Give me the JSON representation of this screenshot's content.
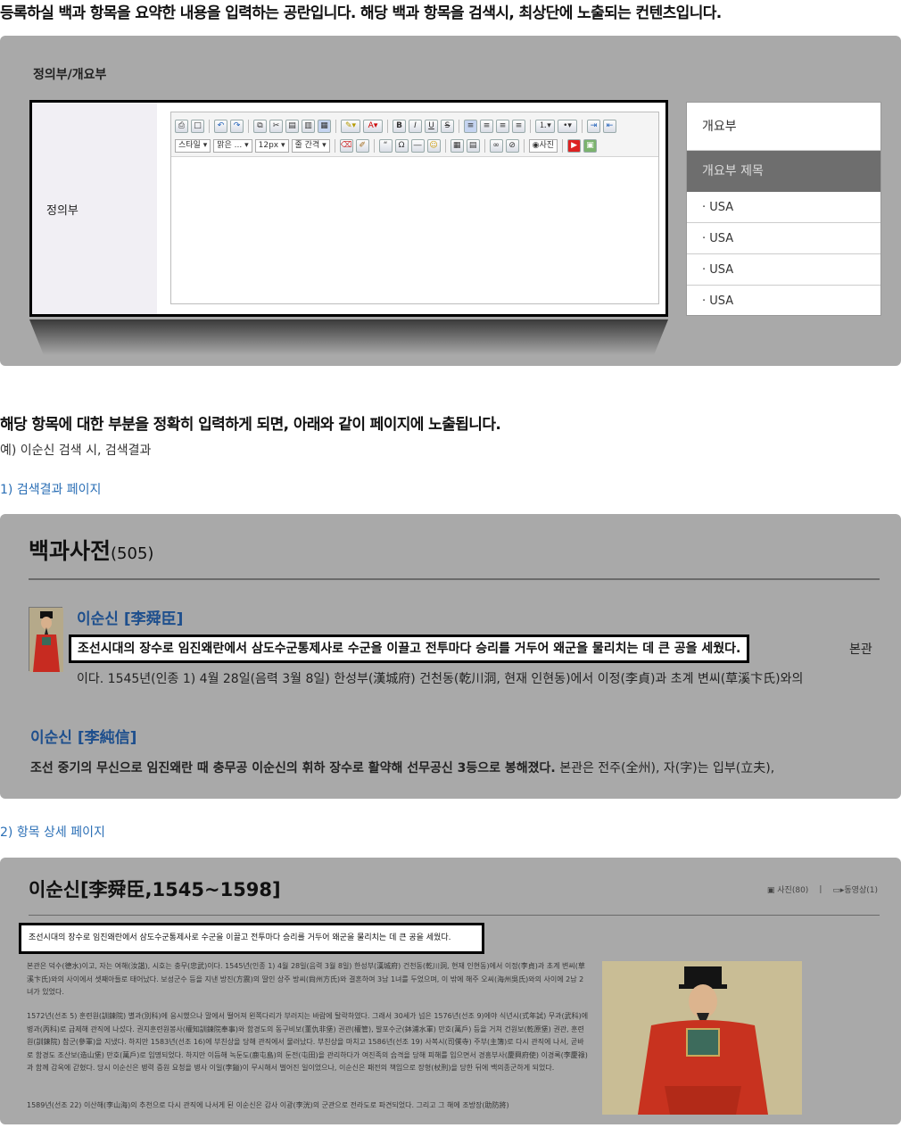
{
  "intro": {
    "heading": "등록하실 백과 항목을 요약한 내용을 입력하는 공란입니다. 해당 백과 항목을 검색시, 최상단에 노출되는 컨텐츠입니다."
  },
  "panel1": {
    "label": "정의부/개요부",
    "form_label": "정의부",
    "toolbar_row2": [
      "스타일",
      "맑은 ...",
      "12px",
      "줄 간격"
    ],
    "toolbar_photo": "사진",
    "sidebar": {
      "header": "개요부",
      "selected": "개요부 제목",
      "items": [
        "USA",
        "USA",
        "USA",
        "USA"
      ]
    }
  },
  "section2": {
    "heading": "해당 항목에 대한 부분을 정확히 입력하게 되면, 아래와 같이 페이지에 노출됩니다.",
    "example": "예) 이순신 검색 시, 검색결과",
    "step1": "1) 검색결과 페이지",
    "step2": "2) 항목 상세 페이지"
  },
  "search_result": {
    "title": "백과사전",
    "count": "(505)",
    "result1": {
      "name": "이순신 [李舜臣]",
      "highlight": "조선시대의 장수로 임진왜란에서 삼도수군통제사로 수군을 이끌고 전투마다 승리를 거두어 왜군을 물리치는 데 큰 공을 세웠다.",
      "after": "본관",
      "line2": "이다. 1545년(인종 1) 4월 28일(음력 3월 8일) 한성부(漢城府) 건천동(乾川洞, 현재 인현동)에서 이정(李貞)과 초계 변씨(草溪卞氏)와의"
    },
    "result2": {
      "name": "이순신 [李純信]",
      "desc_bold": "조선 중기의 무신으로 임진왜란 때 충무공 이순신의 휘하 장수로 활약해 선무공신 3등으로 봉해졌다.",
      "desc_rest": "본관은 전주(全州), 자(字)는 입부(立夫),"
    }
  },
  "detail": {
    "title": "이순신[李舜臣,1545~1598]",
    "photos": "사진(80)",
    "divider": "|",
    "videos": "동영상(1)",
    "highlight": "조선시대의 장수로 임진왜란에서 삼도수군통제사로 수군을 이끌고 전투마다 승리를 거두어 왜군을 물리치는 데 큰 공을 세웠다.",
    "para1": "본관은 덕수(德水)이고, 자는 여해(汝諧), 시호는 충무(忠武)이다. 1545년(인종 1) 4월 28일(음력 3월 8일) 한성부(漢城府) 건천동(乾川洞, 현재 인현동)에서 이정(李貞)과 초계 변씨(草溪卞氏)와의 사이에서 셋째아들로 태어났다. 보성군수 등을 지낸 방진(方震)의 딸인 상주 방씨(尙州方氏)와 결혼하여 3남 1녀를 두었으며, 이 밖에 해주 오씨(海州吳氏)와의 사이에 2남 2녀가 있었다.",
    "para2": "1572년(선조 5) 훈련원(訓鍊院) 별과(別科)에 응시했으나 말에서 떨어져 왼쪽다리가 부러지는 바람에 탈락하였다. 그래서 30세가 넘은 1576년(선조 9)에야 식년시(式年試) 무과(武科)에 병과(丙科)로 급제해 관직에 나섰다. 권지훈련원봉사(權知訓鍊院奉事)와 함경도의 동구비보(董仇非堡) 권관(權管), 발포수군(鉢浦水軍) 만호(萬戶) 등을 거쳐 건원보(乾原堡) 권관, 훈련원(訓鍊院) 참군(參軍)을 지냈다. 하지만 1583년(선조 16)에 부친상을 당해 관직에서 물러났다. 부친상을 마치고 1586년(선조 19) 사복시(司僕寺) 주부(主簿)로 다시 관직에 나서, 곧바로 함경도 조산보(造山堡) 만호(萬戶)로 임명되었다. 하지만 이듬해 녹둔도(鹿屯島)의 둔전(屯田)을 관리하다가 여진족의 습격을 당해 피해를 입으면서 경흥부사(慶興府使) 이경록(李慶祿)과 함께 감옥에 갇혔다. 당시 이순신은 병력 증원 요청을 병사 이일(李鎰)이 무시해서 벌어진 일이었으나, 이순신은 패전의 책임으로 장형(杖刑)을 당한 뒤에 백의종군하게 되었다.",
    "para3": "1589년(선조 22) 이산해(李山海)의 추천으로 다시 관직에 나서게 된 이순신은 감사 이광(李洸)의 군관으로 전라도로 파견되었다. 그리고 그 해에 조방장(助防將)"
  }
}
